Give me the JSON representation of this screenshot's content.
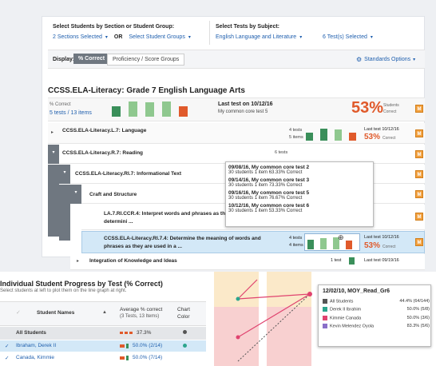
{
  "filters": {
    "section_label": "Select Students by Section or Student Group:",
    "sections_selected": "2 Sections Selected",
    "or_label": "OR",
    "student_groups": "Select Student Groups",
    "tests_label": "Select Tests by Subject:",
    "subject": "English Language and Literature",
    "tests_selected": "6 Test(s) Selected"
  },
  "display": {
    "label": "Display:",
    "pct_correct": "% Correct",
    "proficiency": "Proficiency / Score Groups",
    "standards_options": "Standards Options"
  },
  "header": {
    "title": "CCSS.ELA-Literacy: Grade 7 English Language Arts",
    "pct_label": "% Correct",
    "tests_items": "5 tests / 13 items",
    "last_test": "Last test on 10/12/16",
    "last_test_name": "My common core test 5",
    "pct": "53%",
    "students": "Students",
    "correct": "Correct",
    "badge": "M"
  },
  "rows": [
    {
      "name": "CCSS.ELA-Literacy.L.7: Language",
      "count1": "4 tests",
      "count2": "5 items",
      "last": "Last test 10/12/16",
      "pct": "53%",
      "correct": "Correct",
      "badge": "M"
    },
    {
      "name": "CCSS.ELA-Literacy.R.7: Reading",
      "count1": "6 tests",
      "badge": "M"
    },
    {
      "name": "CCSS.ELA-Literacy.RI.7: Informational Text",
      "badge": "M"
    },
    {
      "name": "Craft and Structure",
      "badge": "M"
    },
    {
      "name": "LA.7.RI.CCR.4: Interpret words and phrases as th",
      "name2": "determini ...",
      "badge": "M"
    },
    {
      "name": "CCSS.ELA-Literacy.RI.7.4: Determine the meaning of words and",
      "name2": "phrases as they are used in a ...",
      "count1": "4 tests",
      "count2": "4 items",
      "last": "Last test 10/12/16",
      "pct": "53%",
      "correct": "Correct",
      "badge": "M"
    },
    {
      "name": "Integration of Knowledge and Ideas",
      "count1": "1 test",
      "last": "Last test 09/19/16"
    }
  ],
  "tooltip": [
    {
      "title": "09/08/16, My common core test 2",
      "detail": "30 students   1 item   63.33% Correct"
    },
    {
      "title": "09/14/16, My common core test 3",
      "detail": "30 students   1 item   73.33% Correct"
    },
    {
      "title": "09/16/16, My common core test 5",
      "detail": "30 students   1 item   76.67% Correct"
    },
    {
      "title": "10/12/16, My common core test 6",
      "detail": "30 students   1 item   53.33% Correct"
    }
  ],
  "progress": {
    "title": "Individual Student Progress by Test (% Correct)",
    "subtitle": "Select students at left to plot them on the line graph at right.",
    "col_names": "Student Names",
    "col_avg": "Average % correct",
    "col_avg2": "(3 Tests, 13 Items)",
    "col_chart": "Chart",
    "col_chart2": "Color",
    "students": [
      {
        "name": "All Students",
        "value": "37.3%"
      },
      {
        "name": "Ibraham, Derek II",
        "value": "50.0% (2/14)"
      },
      {
        "name": "Canada, Kimmie",
        "value": "50.0% (7/14)"
      }
    ]
  },
  "legend": {
    "title": "12/02/10, MOY_Read_Gr6",
    "items": [
      {
        "name": "All Students",
        "value": "44.4% (64/144)",
        "color": "#555555"
      },
      {
        "name": "Derek II Ibrahim",
        "value": "50.0% (5/8)",
        "color": "#2ca58d"
      },
      {
        "name": "Kimmie Canada",
        "value": "50.0% (3/6)",
        "color": "#e0436f"
      },
      {
        "name": "Kevin Melendez Oyola",
        "value": "83.3% (5/6)",
        "color": "#8a6fc8"
      }
    ]
  }
}
